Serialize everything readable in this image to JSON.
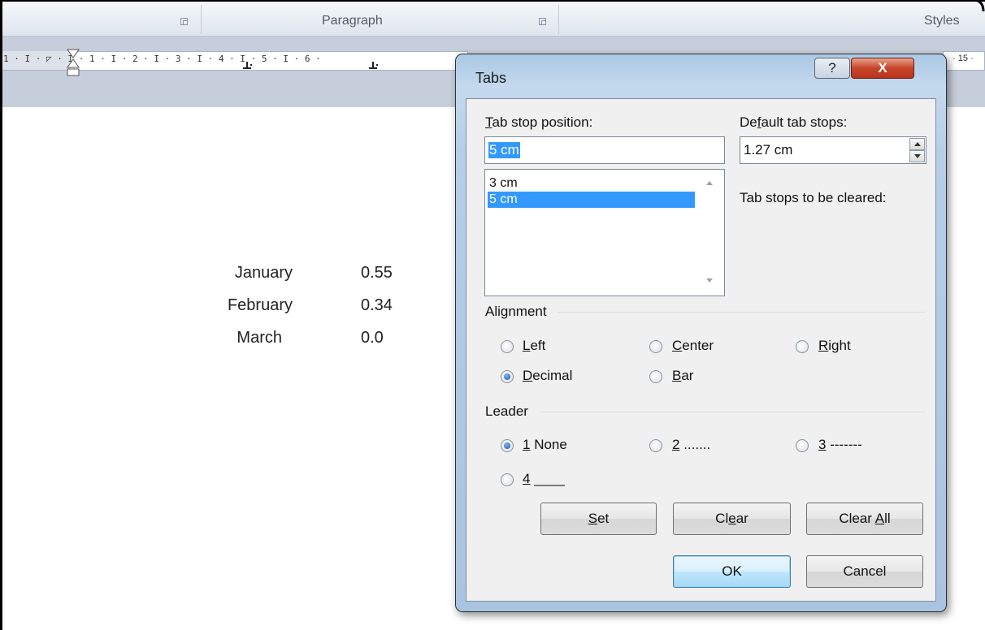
{
  "ribbon": {
    "paragraph_label": "Paragraph",
    "styles_label": "Styles"
  },
  "ruler": {
    "text": "1 · I · ◸ · I · 1 · I · 2 · I · 3 · I · 4 · I · 5 · I · 6 ·",
    "right_text": "· 15 ·"
  },
  "document": {
    "rows": [
      {
        "month": "January",
        "value": "0.55"
      },
      {
        "month": "February",
        "value": "0.34"
      },
      {
        "month": "March",
        "value": "0.0"
      }
    ]
  },
  "dialog": {
    "title": "Tabs",
    "help_label": "?",
    "close_label": "X",
    "tab_stop_position_label_u": "T",
    "tab_stop_position_label_rest": "ab stop position:",
    "tab_stop_position_value": "5 cm",
    "tab_stops_list": [
      "3 cm",
      "5 cm"
    ],
    "selected_list_item": "5 cm",
    "default_tab_stops_label_pre": "De",
    "default_tab_stops_label_u": "f",
    "default_tab_stops_label_post": "ault tab stops:",
    "default_tab_stops_value": "1.27 cm",
    "tab_stops_cleared_label": "Tab stops to be cleared:",
    "alignment_label": "Alignment",
    "alignment_options": [
      {
        "u": "L",
        "rest": "eft",
        "checked": false
      },
      {
        "u": "C",
        "rest": "enter",
        "checked": false
      },
      {
        "u": "R",
        "rest": "ight",
        "checked": false
      },
      {
        "u": "D",
        "rest": "ecimal",
        "checked": true
      },
      {
        "u": "B",
        "rest": "ar",
        "checked": false
      }
    ],
    "leader_label": "Leader",
    "leader_options": [
      {
        "u": "1",
        "rest": " None",
        "checked": true
      },
      {
        "u": "2",
        "rest": " .......",
        "checked": false
      },
      {
        "u": "3",
        "rest": " -------",
        "checked": false
      },
      {
        "u": "4",
        "rest": " ____",
        "checked": false
      }
    ],
    "set_button_u": "S",
    "set_button_rest": "et",
    "clear_button_pre": "Cl",
    "clear_button_u": "e",
    "clear_button_post": "ar",
    "clear_all_button_pre": "Clear ",
    "clear_all_button_u": "A",
    "clear_all_button_post": "ll",
    "ok_button": "OK",
    "cancel_button": "Cancel"
  }
}
